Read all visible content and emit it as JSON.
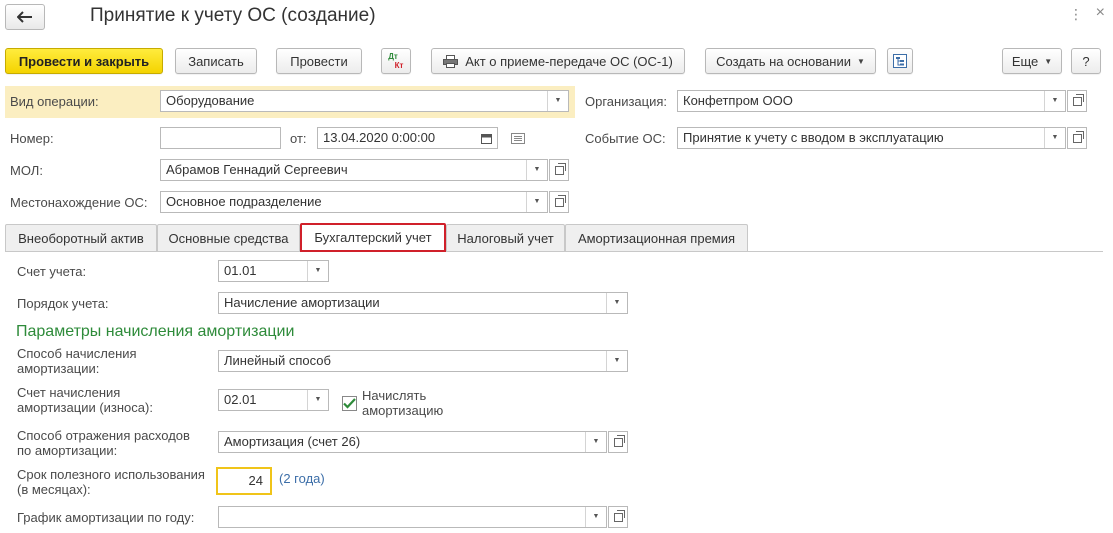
{
  "window": {
    "title": "Принятие к учету ОС (создание)",
    "menu_icon": "more-vertical-icon",
    "close_icon": "close-icon"
  },
  "toolbar": {
    "post_close": "Провести и закрыть",
    "save": "Записать",
    "post": "Провести",
    "dtkt_top": "Дт",
    "dtkt_bottom": "Кт",
    "act": "Акт о приеме-передаче ОС (ОС-1)",
    "create_based": "Создать на основании",
    "more": "Еще",
    "help": "?"
  },
  "header": {
    "operation_label": "Вид операции:",
    "operation_value": "Оборудование",
    "number_label": "Номер:",
    "number_value": "",
    "from_label": "от:",
    "date_value": "13.04.2020  0:00:00",
    "mol_label": "МОЛ:",
    "mol_value": "Абрамов Геннадий Сергеевич",
    "location_label": "Местонахождение ОС:",
    "location_value": "Основное подразделение",
    "org_label": "Организация:",
    "org_value": "Конфетпром ООО",
    "event_label": "Событие ОС:",
    "event_value": "Принятие к учету с вводом в эксплуатацию"
  },
  "tabs": [
    {
      "label": "Внеоборотный актив"
    },
    {
      "label": "Основные средства"
    },
    {
      "label": "Бухгалтерский учет"
    },
    {
      "label": "Налоговый учет"
    },
    {
      "label": "Амортизационная премия"
    }
  ],
  "accounting": {
    "account_label": "Счет учета:",
    "account_value": "01.01",
    "order_label": "Порядок учета:",
    "order_value": "Начисление амортизации",
    "section_title": "Параметры начисления амортизации",
    "method_label_1": "Способ начисления",
    "method_label_2": "амортизации:",
    "method_value": "Линейный способ",
    "deprec_account_label_1": "Счет начисления",
    "deprec_account_label_2": "амортизации (износа):",
    "deprec_account_value": "02.01",
    "charge_checkbox_1": "Начислять",
    "charge_checkbox_2": "амортизацию",
    "expense_label_1": "Способ отражения расходов",
    "expense_label_2": "по амортизации:",
    "expense_value": "Амортизация (счет 26)",
    "useful_life_label_1": "Срок полезного использования",
    "useful_life_label_2": "(в месяцах):",
    "useful_life_value": "24",
    "useful_life_hint": "(2 года)",
    "schedule_label": "График амортизации по году:",
    "schedule_value": ""
  },
  "colors": {
    "primary": "#f4d300",
    "active_tab_border": "#d0202a",
    "section": "#2e8b3a",
    "link": "#3c6ea8",
    "highlight": "#fbeec1"
  }
}
